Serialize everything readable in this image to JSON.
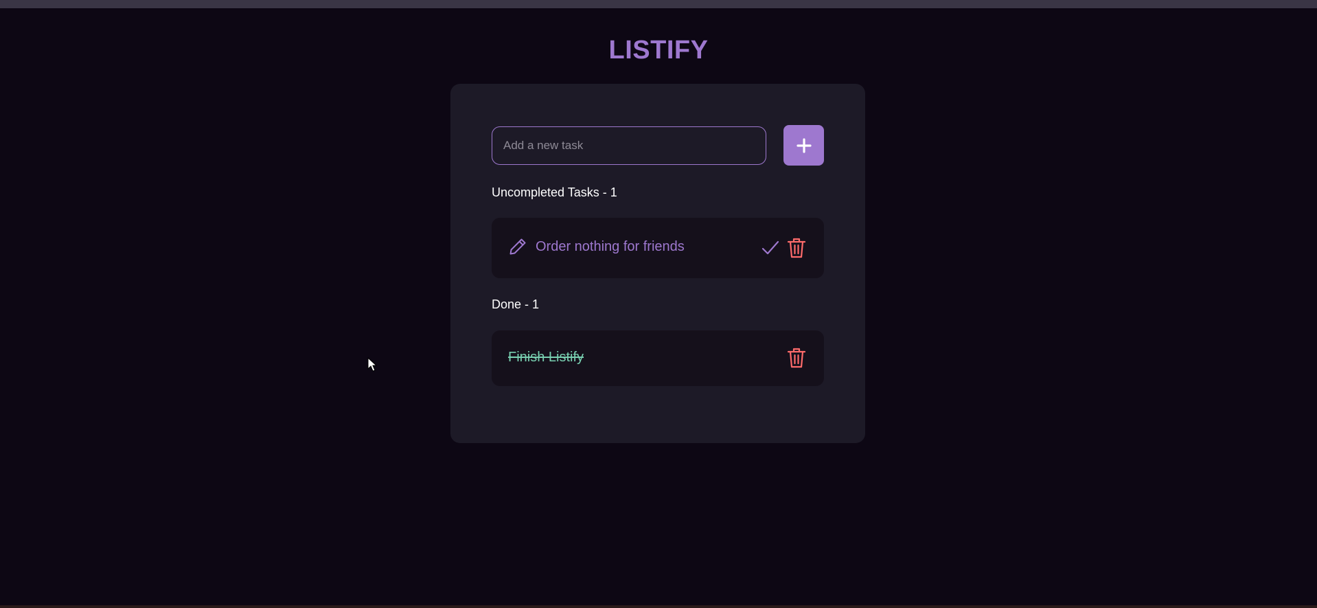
{
  "app": {
    "title": "LISTIFY"
  },
  "new_task": {
    "placeholder": "Add a new task",
    "add_icon": "plus-icon"
  },
  "uncompleted": {
    "heading": "Uncompleted Tasks - 1",
    "tasks": [
      {
        "text": "Order nothing for friends",
        "edit_icon": "pencil-icon",
        "complete_icon": "checkmark-icon",
        "delete_icon": "trash-icon"
      }
    ]
  },
  "done": {
    "heading": "Done - 1",
    "tasks": [
      {
        "text": "Finish Listify",
        "delete_icon": "trash-icon"
      }
    ]
  },
  "colors": {
    "background": "#0d0714",
    "card": "#1d1a27",
    "item": "#15101b",
    "accent": "#9e78cf",
    "done_text": "#78cfb0",
    "delete": "#ff6b6b"
  }
}
